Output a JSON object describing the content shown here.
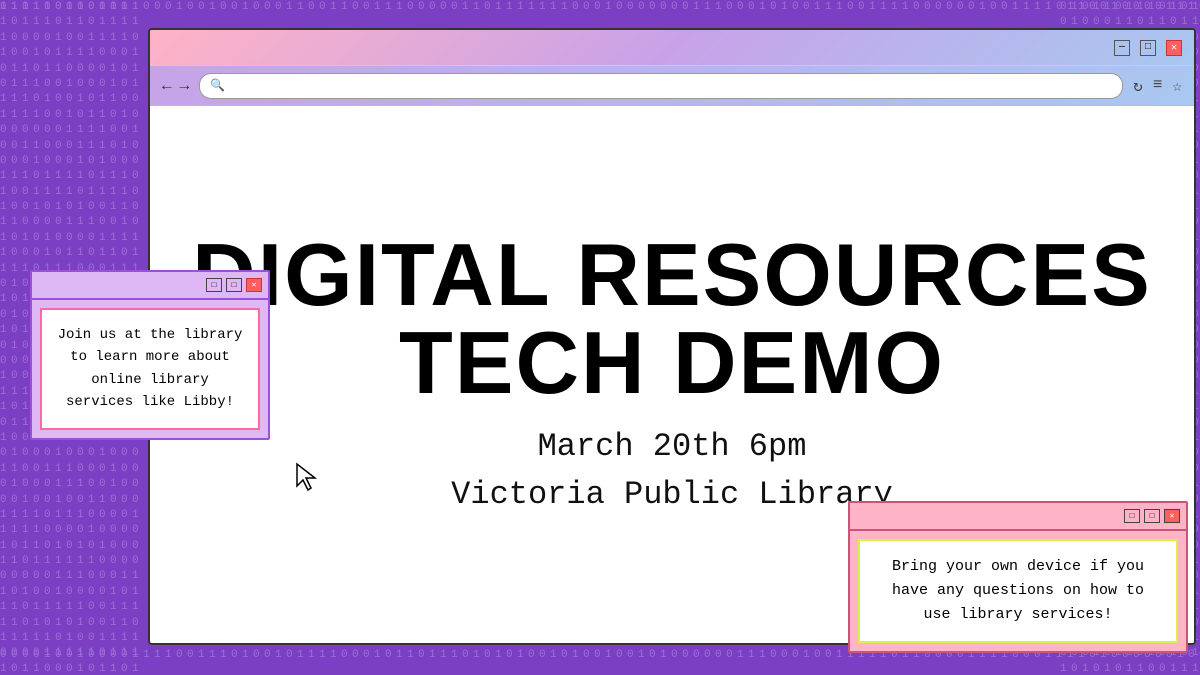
{
  "background": {
    "color": "#7B3FC4"
  },
  "browser": {
    "title": "Digital Resources Tech Demo",
    "controls": {
      "minimize": "—",
      "maximize": "□",
      "close": "✕"
    },
    "nav": {
      "back": "←",
      "forward": "→",
      "search_placeholder": "",
      "reload": "↻",
      "menu": "≡",
      "bookmark": "☆"
    }
  },
  "main_content": {
    "title_line1": "DIGITAL RESOURCES",
    "title_line2": "TECH DEMO",
    "date": "March 20th 6pm",
    "location": "Victoria Public Library"
  },
  "popup_left": {
    "body_text": "Join us at the library to learn more about online library services like Libby!"
  },
  "popup_right": {
    "body_text": "Bring your own device if you have any questions on how to use library services!"
  },
  "colors": {
    "background": "#7B3FC4",
    "browser_gradient_start": "#FFB3C6",
    "browser_gradient_mid": "#C8A2E8",
    "browser_gradient_end": "#A8C8F0",
    "popup_left_bg": "#DDB8F5",
    "popup_right_bg": "#FFB3C6",
    "accent_pink": "#FF69A0",
    "accent_yellow": "#DDEE44"
  }
}
